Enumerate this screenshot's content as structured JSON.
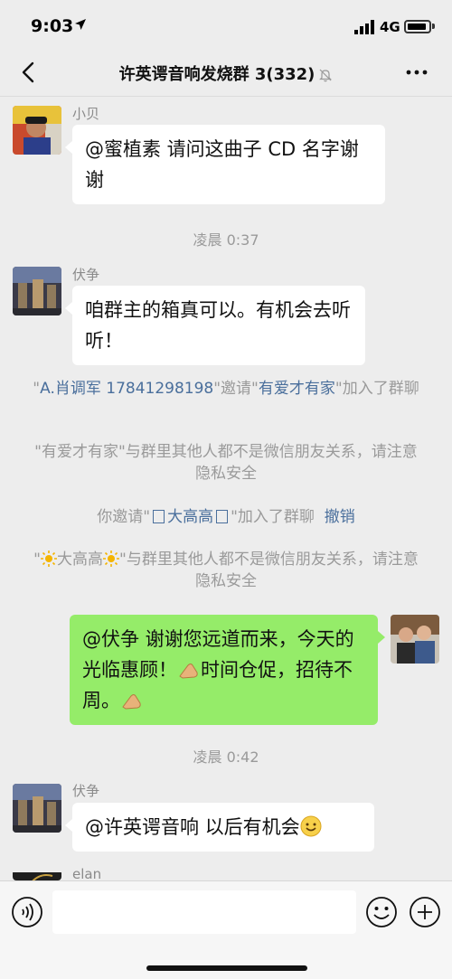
{
  "status": {
    "time": "9:03",
    "network": "4G"
  },
  "nav": {
    "title": "许英谔音响发烧群 3(332)"
  },
  "messages": [
    {
      "sender": "小贝",
      "text": "@蜜植素 请问这曲子 CD 名字谢谢"
    },
    {
      "timestamp": "凌晨 0:37"
    },
    {
      "sender": "伏争",
      "text": "咱群主的箱真可以。有机会去听听！"
    }
  ],
  "system": {
    "invite1_q1": "\"",
    "invite1_user": "A.肖调军 17841298198",
    "invite1_mid": "\"邀请\"",
    "invite1_target": "有爱才有家",
    "invite1_end": "\"加入了群聊",
    "notice1": "\"有爱才有家\"与群里其他人都不是微信朋友关系，请注意隐私安全",
    "invite2_pre": "你邀请\"",
    "invite2_name": "大高高",
    "invite2_post": "\"加入了群聊",
    "invite2_undo": "撤销",
    "notice2_pre": "\"",
    "notice2_name": "大高高",
    "notice2_post": "\"与群里其他人都不是微信朋友关系，请注意隐私安全"
  },
  "self_message": {
    "text_1": "@伏争 谢谢您远道而来，今天的光临惠顾！",
    "text_2": "时间仓促，招待不周。"
  },
  "timestamp2": "凌晨 0:42",
  "message4": {
    "sender": "伏争",
    "text": "@许英谔音响 以后有机会"
  },
  "message5": {
    "sender": "elan"
  },
  "icons": {
    "back": "chevron-left-icon",
    "mute": "bell-off-icon",
    "more": "more-dots-icon",
    "voice": "voice-icon",
    "emoji": "emoji-icon",
    "plus": "plus-icon"
  },
  "colors": {
    "bubble_self": "#95ec69",
    "link": "#4a6f9c",
    "background": "#ededed"
  }
}
